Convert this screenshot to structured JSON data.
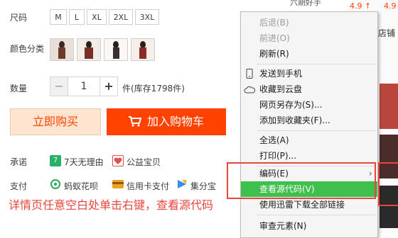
{
  "product": {
    "size_label": "尺码",
    "sizes": [
      "M",
      "L",
      "XL",
      "2XL",
      "3XL"
    ],
    "color_label": "颜色分类",
    "qty_label": "数量",
    "qty_minus": "−",
    "qty_value": "1",
    "qty_plus": "+",
    "stock_text": "件(库存1798件)",
    "buy_now": "立即购买",
    "add_to_cart": "加入购物车",
    "promise_label": "承诺",
    "promise_7day": "7天无理由",
    "promise_7day_icon": "7",
    "promise_charity": "公益宝贝",
    "pay_label": "支付",
    "pay_huabei": "蚂蚁花呗",
    "pay_credit": "信用卡支付",
    "pay_jifen": "集分宝",
    "annotation": "详情页任意空白处单击右键，查看源代码"
  },
  "right_panel": {
    "top_text": "六期好手",
    "rating1": "4.9 ↑",
    "rating2": "4.9",
    "shop_partial": "店铺"
  },
  "context_menu": {
    "back": "后退(B)",
    "forward": "前进(O)",
    "refresh": "刷新(R)",
    "send_phone": "发送到手机",
    "save_cloud": "收藏到云盘",
    "save_as": "网页另存为(S)...",
    "add_fav": "添加到收藏夹(F)...",
    "select_all": "全选(A)",
    "print": "打印(P)...",
    "encoding": "编码(E)",
    "view_source": "查看源代码(V)",
    "download_all": "使用迅雷下载全部链接",
    "inspect": "审查元素(N)"
  },
  "colors": {
    "accent": "#ff4200",
    "highlight": "#3fbf4e",
    "annotation": "#e8453c",
    "rating": "#f40"
  }
}
